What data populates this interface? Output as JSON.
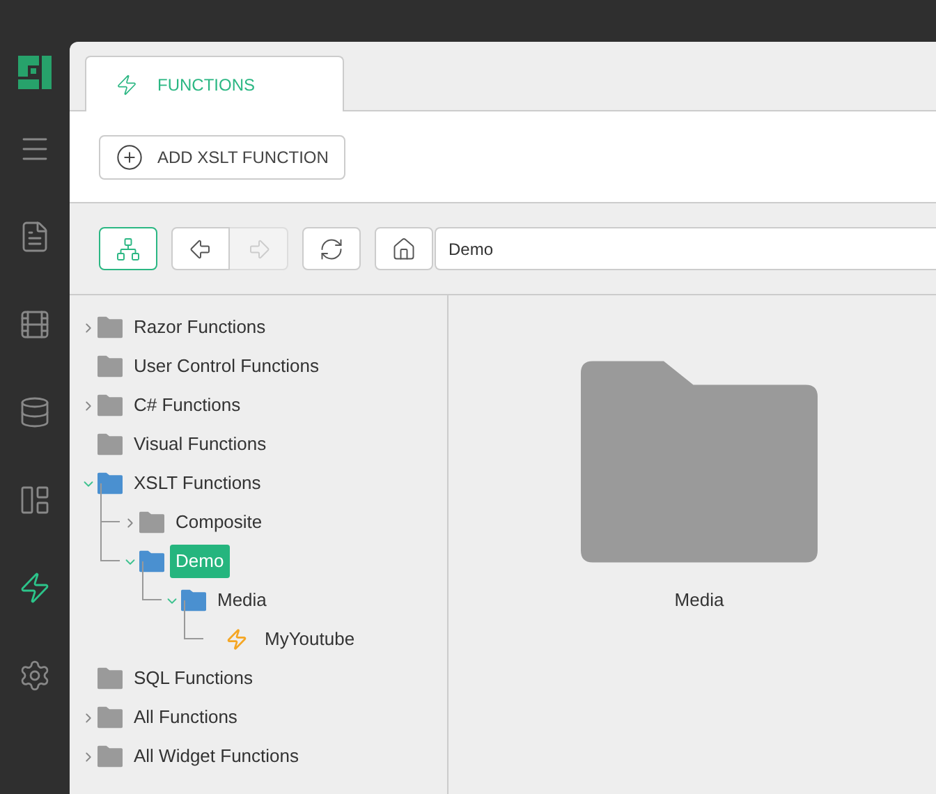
{
  "sidebar": {
    "items": [
      {
        "kind": "menu",
        "selected": false
      },
      {
        "kind": "document",
        "selected": false
      },
      {
        "kind": "film",
        "selected": false
      },
      {
        "kind": "database",
        "selected": false
      },
      {
        "kind": "layout",
        "selected": false
      },
      {
        "kind": "functions",
        "selected": true
      },
      {
        "kind": "settings",
        "selected": false
      }
    ]
  },
  "tabs": [
    {
      "label": "FUNCTIONS",
      "selected": true
    }
  ],
  "actions": [
    {
      "label": "ADD XSLT FUNCTION"
    }
  ],
  "toolbar": {
    "buttons": [
      {
        "kind": "tree",
        "selected": true,
        "disabled": false
      },
      {
        "kind": "back",
        "selected": false,
        "disabled": false
      },
      {
        "kind": "forward",
        "selected": false,
        "disabled": true
      },
      {
        "kind": "refresh",
        "selected": false,
        "disabled": false
      },
      {
        "kind": "home",
        "selected": false,
        "disabled": false
      }
    ],
    "address": "Demo"
  },
  "tree": [
    {
      "label": "Razor Functions",
      "kind": "folder",
      "expanded": false,
      "selected": false
    },
    {
      "label": "User Control Functions",
      "kind": "folder",
      "selected": false
    },
    {
      "label": "C# Functions",
      "kind": "folder",
      "expanded": false,
      "selected": false
    },
    {
      "label": "Visual Functions",
      "kind": "folder",
      "selected": false
    },
    {
      "label": "XSLT Functions",
      "kind": "folder",
      "expanded": true,
      "selected": false,
      "children": [
        {
          "label": "Composite",
          "kind": "folder",
          "expanded": false,
          "selected": false
        },
        {
          "label": "Demo",
          "kind": "folder",
          "expanded": true,
          "selected": true,
          "children": [
            {
              "label": "Media",
              "kind": "folder",
              "expanded": true,
              "selected": false,
              "children": [
                {
                  "label": "MyYoutube",
                  "kind": "function",
                  "selected": false
                }
              ]
            }
          ]
        }
      ]
    },
    {
      "label": "SQL Functions",
      "kind": "folder",
      "selected": false
    },
    {
      "label": "All Functions",
      "kind": "folder",
      "expanded": false,
      "selected": false
    },
    {
      "label": "All Widget Functions",
      "kind": "folder",
      "expanded": false,
      "selected": false
    }
  ],
  "content": {
    "items": [
      {
        "label": "Media",
        "kind": "folder"
      }
    ]
  }
}
